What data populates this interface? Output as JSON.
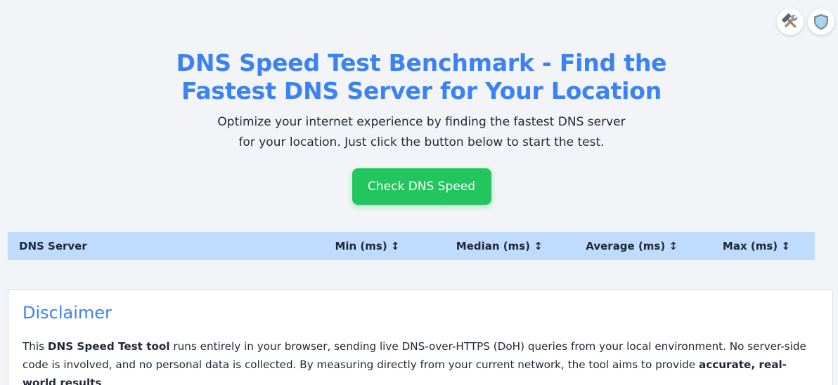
{
  "header": {
    "buttons": [
      {
        "name": "tools",
        "icon": "hammer-wrench-icon"
      },
      {
        "name": "privacy",
        "icon": "shield-icon"
      }
    ]
  },
  "hero": {
    "title": "DNS Speed Test Benchmark - Find the Fastest DNS Server for Your Location",
    "subtitle": "Optimize your internet experience by finding the fastest DNS server for your location. Just click the button below to start the test.",
    "button_label": "Check DNS Speed"
  },
  "table": {
    "columns": [
      "DNS Server",
      "Min (ms) ↕",
      "Median (ms) ↕",
      "Average (ms) ↕",
      "Max (ms) ↕"
    ],
    "rows": []
  },
  "disclaimer": {
    "heading": "Disclaimer",
    "text_1": "This ",
    "bold_1": "DNS Speed Test tool",
    "text_2": " runs entirely in your browser, sending live DNS-over-HTTPS (DoH) queries from your local environment. No server-side code is involved, and no personal data is collected. By measuring directly from your current network, the tool aims to provide ",
    "bold_2": "accurate, real-world results",
    "text_3": "."
  },
  "colors": {
    "accent": "#3b82f6",
    "button": "#22c55e",
    "table_header": "#bfdbfe",
    "background": "#f2f4f7"
  }
}
